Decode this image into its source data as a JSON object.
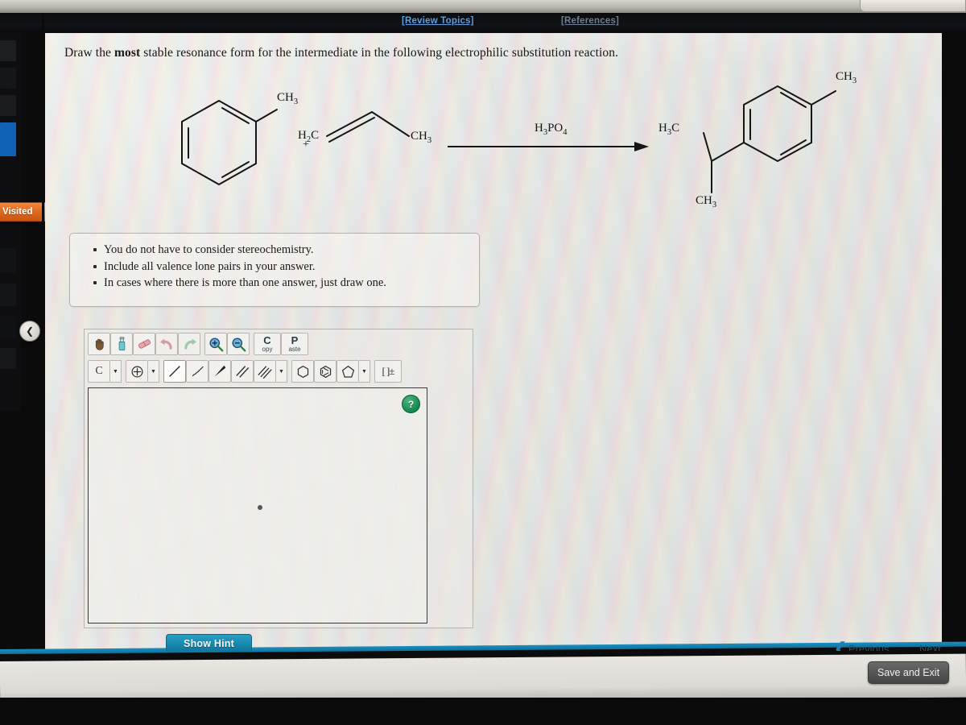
{
  "topbar": {
    "review_topics": "[Review Topics]",
    "references": "[References]"
  },
  "sidebar": {
    "visited_badge": "Visited",
    "collapse_icon": "chevron-left-icon"
  },
  "question": {
    "prefix": "Draw the ",
    "emphasis": "most",
    "suffix": " stable resonance form for the intermediate in the following electrophilic substitution reaction."
  },
  "reaction": {
    "plus": "+",
    "reagent": "H3PO4",
    "reactant1_label": "CH3",
    "reactant2_left": "H2C",
    "reactant2_right": "CH3",
    "product_top_label": "CH3",
    "product_left_label": "H3C",
    "product_bottom_label": "CH3"
  },
  "notes": {
    "items": [
      "You do not have to consider stereochemistry.",
      "Include all valence lone pairs in your answer.",
      "In cases where there is more than one answer, just draw one."
    ]
  },
  "toolbar": {
    "row1": [
      {
        "name": "hand-tool-icon",
        "label": ""
      },
      {
        "name": "eraser-spray-icon",
        "label": ""
      },
      {
        "name": "eraser-icon",
        "label": ""
      },
      {
        "name": "undo-icon",
        "label": ""
      },
      {
        "name": "redo-icon",
        "label": ""
      },
      {
        "name": "zoom-in-icon",
        "label": ""
      },
      {
        "name": "zoom-out-icon",
        "label": ""
      }
    ],
    "copy_big": "C",
    "copy_small": "opy",
    "paste_big": "P",
    "paste_small": "aste",
    "row2": {
      "element_label": "C",
      "charge_icon": "plus-circle-icon",
      "bond_single": "single-bond-icon",
      "bond_hash": "hashed-bond-icon",
      "bond_wedge": "wedge-bond-icon",
      "bond_double": "double-bond-icon",
      "bond_triple": "triple-bond-icon",
      "ring_hexagon": "hexagon-ring-icon",
      "ring_benzene": "benzene-ring-icon",
      "ring_pentagon": "pentagon-ring-icon",
      "bracket_charge": "[ ]±"
    },
    "caret": "▼"
  },
  "canvas": {
    "help_label": "?"
  },
  "buttons": {
    "show_hint": "Show Hint",
    "previous": "Previous",
    "next": "Next",
    "save_and_exit": "Save and Exit"
  },
  "colors": {
    "link_active": "#5d9ee0",
    "link_muted": "#6f7f92",
    "visited_badge": "#df6a1f",
    "hint_button": "#1689ae",
    "help_button": "#148a4e",
    "nav_chevron": "#1f7fb5",
    "sidebar_active": "#0f62b5"
  }
}
